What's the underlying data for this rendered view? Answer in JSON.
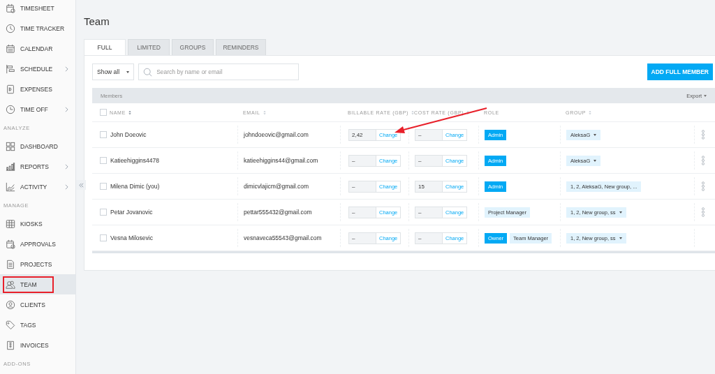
{
  "sidebar": {
    "sections": [
      {
        "items": [
          {
            "label": "TIMESHEET",
            "has_submenu": false,
            "selected": false,
            "annotated": false
          },
          {
            "label": "TIME TRACKER",
            "has_submenu": false,
            "selected": false,
            "annotated": false
          },
          {
            "label": "CALENDAR",
            "has_submenu": false,
            "selected": false,
            "annotated": false
          },
          {
            "label": "SCHEDULE",
            "has_submenu": true,
            "selected": false,
            "annotated": false
          },
          {
            "label": "EXPENSES",
            "has_submenu": false,
            "selected": false,
            "annotated": false
          },
          {
            "label": "TIME OFF",
            "has_submenu": true,
            "selected": false,
            "annotated": false
          }
        ]
      },
      {
        "heading": "ANALYZE",
        "items": [
          {
            "label": "DASHBOARD",
            "has_submenu": false,
            "selected": false,
            "annotated": false
          },
          {
            "label": "REPORTS",
            "has_submenu": true,
            "selected": false,
            "annotated": false
          },
          {
            "label": "ACTIVITY",
            "has_submenu": true,
            "selected": false,
            "annotated": false
          }
        ]
      },
      {
        "heading": "MANAGE",
        "items": [
          {
            "label": "KIOSKS",
            "has_submenu": false,
            "selected": false,
            "annotated": false
          },
          {
            "label": "APPROVALS",
            "has_submenu": false,
            "selected": false,
            "annotated": false
          },
          {
            "label": "PROJECTS",
            "has_submenu": false,
            "selected": false,
            "annotated": false
          },
          {
            "label": "TEAM",
            "has_submenu": false,
            "selected": true,
            "annotated": true
          },
          {
            "label": "CLIENTS",
            "has_submenu": false,
            "selected": false,
            "annotated": false
          },
          {
            "label": "TAGS",
            "has_submenu": false,
            "selected": false,
            "annotated": false
          },
          {
            "label": "INVOICES",
            "has_submenu": false,
            "selected": false,
            "annotated": false
          }
        ]
      },
      {
        "heading": "ADD-ONS"
      }
    ]
  },
  "page_title": "Team",
  "tabs": [
    {
      "label": "FULL",
      "selected": true
    },
    {
      "label": "LIMITED",
      "selected": false
    },
    {
      "label": "GROUPS",
      "selected": false
    },
    {
      "label": "REMINDERS",
      "selected": false
    }
  ],
  "filter": {
    "value": "Show all"
  },
  "search": {
    "placeholder": "Search by name or email"
  },
  "add_button": "ADD FULL MEMBER",
  "table": {
    "title": "Members",
    "export": "Export",
    "select_all_checked": false,
    "columns": [
      {
        "label": "NAME",
        "sortable": true
      },
      {
        "label": "EMAIL",
        "sortable": true
      },
      {
        "label": "BILLABLE RATE (GBP)",
        "sortable": true
      },
      {
        "label": "COST RATE (GBP)",
        "sortable": true
      },
      {
        "label": "ROLE",
        "sortable": false
      },
      {
        "label": "GROUP",
        "sortable": true
      }
    ],
    "rows": [
      {
        "checked": false,
        "name": "John Doeovic",
        "email": "johndoeovic@gmail.com",
        "billable": "2,42",
        "billable_action": "Change",
        "cost": "–",
        "cost_action": "Change",
        "roles": [
          {
            "label": "Admin",
            "kind": "solid"
          }
        ],
        "group": "AleksaG",
        "group_dropdown": true,
        "menu": true
      },
      {
        "checked": false,
        "name": "Katieehiggins4478",
        "email": "katieehiggins44@gmail.com",
        "billable": "–",
        "billable_action": "Change",
        "cost": "–",
        "cost_action": "Change",
        "roles": [
          {
            "label": "Admin",
            "kind": "solid"
          }
        ],
        "group": "AleksaG",
        "group_dropdown": true,
        "menu": true
      },
      {
        "checked": false,
        "name": "Milena Dimic (you)",
        "email": "dimicvlajicm@gmail.com",
        "billable": "–",
        "billable_action": "Change",
        "cost": "15",
        "cost_action": "Change",
        "roles": [
          {
            "label": "Admin",
            "kind": "solid"
          }
        ],
        "group": "1, 2, AleksaG, New group, ...",
        "group_dropdown": false,
        "menu": true
      },
      {
        "checked": false,
        "name": "Petar Jovanovic",
        "email": "pettar555432@gmail.com",
        "billable": "–",
        "billable_action": "Change",
        "cost": "–",
        "cost_action": "Change",
        "roles": [
          {
            "label": "Project Manager",
            "kind": "soft"
          }
        ],
        "group": "1, 2, New group, ss",
        "group_dropdown": true,
        "menu": true
      },
      {
        "checked": false,
        "name": "Vesna Milosevic",
        "email": "vesnaveca55543@gmail.com",
        "billable": "–",
        "billable_action": "Change",
        "cost": "–",
        "cost_action": "Change",
        "roles": [
          {
            "label": "Owner",
            "kind": "solid"
          },
          {
            "label": "Team Manager",
            "kind": "soft"
          }
        ],
        "group": "1, 2, New group, ss",
        "group_dropdown": true,
        "menu": false
      }
    ]
  }
}
